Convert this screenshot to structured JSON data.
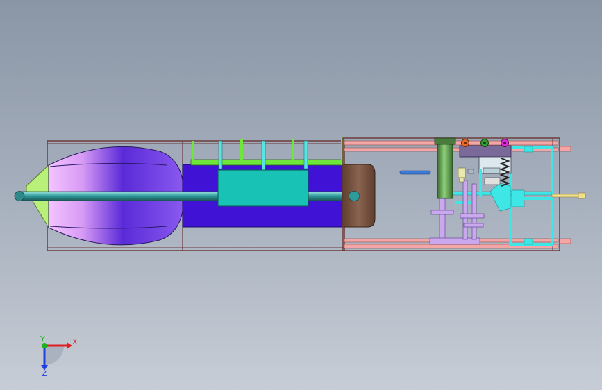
{
  "viewport": {
    "background_top": "#8a96a6",
    "background_bottom": "#c7cdd6"
  },
  "colors": {
    "frame_outline": "#6b3a3a",
    "rail_pink": "#f4a6a6",
    "tank_lilac": "#f0b0ff",
    "tank_blue": "#5a2ad8",
    "body_indigo": "#3f12d6",
    "pipe_teal": "#3aa7a7",
    "housing_teal": "#18c2b4",
    "end_cap_brown": "#7a5642",
    "nose_lime": "#b8f07a",
    "rail_green": "#6fe63a",
    "post_cyan": "#59e3e3",
    "cylinder_green": "#5a9a4a",
    "support_violet": "#c9a8ee",
    "bracket_cyan": "#3fe6e6",
    "knob_orange": "#e86a2a",
    "knob_green": "#3a9a3a",
    "knob_magenta": "#d92ad9",
    "spring_black": "#222222",
    "rod_tip_yellow": "#f0e08a"
  },
  "triad": {
    "x_label": "X",
    "y_label": "Y",
    "z_label": "Z",
    "x_color": "#e02020",
    "y_color": "#20b020",
    "z_color": "#2040e0"
  }
}
